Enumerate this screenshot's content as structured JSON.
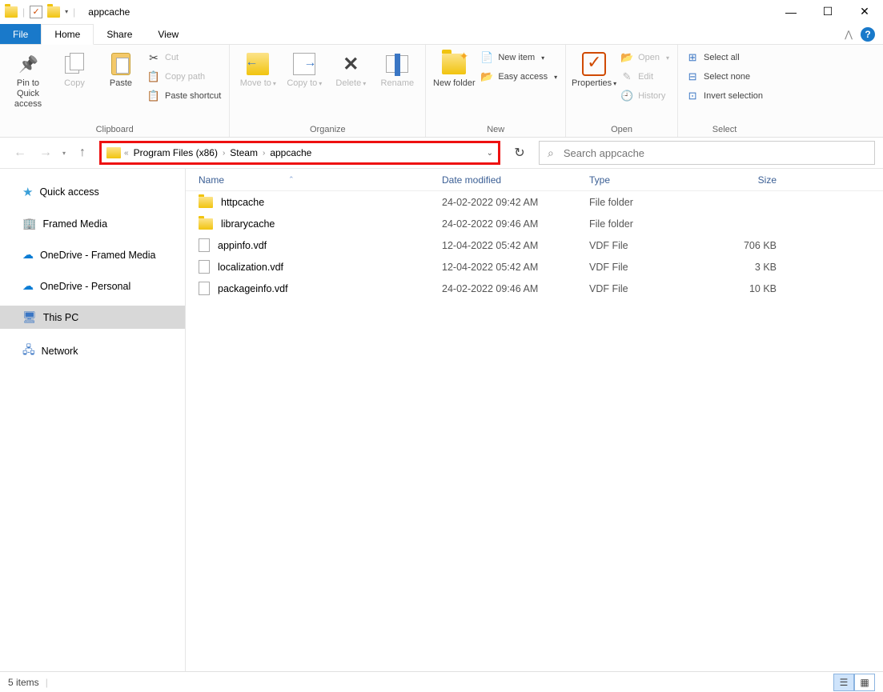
{
  "window": {
    "title": "appcache"
  },
  "tabs": {
    "file": "File",
    "home": "Home",
    "share": "Share",
    "view": "View"
  },
  "ribbon": {
    "clipboard": {
      "label": "Clipboard",
      "pin": "Pin to Quick access",
      "copy": "Copy",
      "paste": "Paste",
      "cut": "Cut",
      "copy_path": "Copy path",
      "paste_shortcut": "Paste shortcut"
    },
    "organize": {
      "label": "Organize",
      "move_to": "Move to",
      "copy_to": "Copy to",
      "delete": "Delete",
      "rename": "Rename"
    },
    "new": {
      "label": "New",
      "new_folder": "New folder",
      "new_item": "New item",
      "easy_access": "Easy access"
    },
    "open": {
      "label": "Open",
      "properties": "Properties",
      "open": "Open",
      "edit": "Edit",
      "history": "History"
    },
    "select": {
      "label": "Select",
      "select_all": "Select all",
      "select_none": "Select none",
      "invert": "Invert selection"
    }
  },
  "address": {
    "segments": [
      "Program Files (x86)",
      "Steam",
      "appcache"
    ]
  },
  "search": {
    "placeholder": "Search appcache"
  },
  "nav": {
    "quick_access": "Quick access",
    "framed_media": "Framed Media",
    "onedrive_framed": "OneDrive - Framed Media",
    "onedrive_personal": "OneDrive - Personal",
    "this_pc": "This PC",
    "network": "Network"
  },
  "columns": {
    "name": "Name",
    "date": "Date modified",
    "type": "Type",
    "size": "Size"
  },
  "files": [
    {
      "name": "httpcache",
      "date": "24-02-2022 09:42 AM",
      "type": "File folder",
      "size": ""
    },
    {
      "name": "librarycache",
      "date": "24-02-2022 09:46 AM",
      "type": "File folder",
      "size": ""
    },
    {
      "name": "appinfo.vdf",
      "date": "12-04-2022 05:42 AM",
      "type": "VDF File",
      "size": "706 KB"
    },
    {
      "name": "localization.vdf",
      "date": "12-04-2022 05:42 AM",
      "type": "VDF File",
      "size": "3 KB"
    },
    {
      "name": "packageinfo.vdf",
      "date": "24-02-2022 09:46 AM",
      "type": "VDF File",
      "size": "10 KB"
    }
  ],
  "status": {
    "items": "5 items"
  }
}
